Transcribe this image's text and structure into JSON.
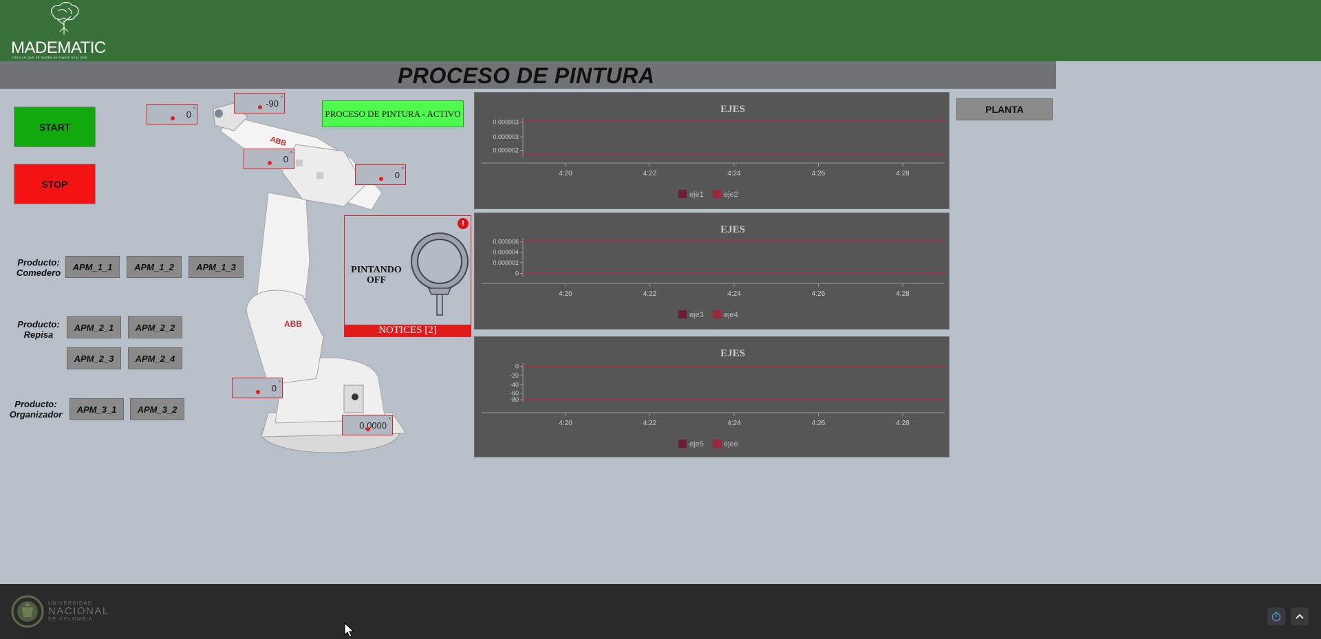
{
  "header": {
    "brand": "MADEMATIC",
    "brand_sub": "TODO LO QUE SE SUEÑA SE PUEDE REALIZAR",
    "title": "PROCESO DE PINTURA"
  },
  "controls": {
    "start_label": "START",
    "stop_label": "STOP",
    "status_text": "PROCESO DE PINTURA - ACTIVO",
    "planta_label": "PLANTA"
  },
  "products": [
    {
      "label": "Producto: Comedero",
      "label_line1": "Producto:",
      "label_line2": "Comedero",
      "buttons": [
        "APM_1_1",
        "APM_1_2",
        "APM_1_3"
      ]
    },
    {
      "label": "Producto: Repisa",
      "label_line1": "Producto:",
      "label_line2": "Repisa",
      "buttons": [
        "APM_2_1",
        "APM_2_2",
        "APM_2_3",
        "APM_2_4"
      ]
    },
    {
      "label": "Producto: Organizador",
      "label_line1": "Producto:",
      "label_line2": "Organizador",
      "buttons": [
        "APM_3_1",
        "APM_3_2"
      ]
    }
  ],
  "angles": {
    "a1": "0",
    "a2": "-90",
    "a3": "0",
    "a4": "0",
    "a5": "0",
    "a6": "0,0000",
    "unit": "°"
  },
  "paint": {
    "label_line1": "PINTANDO",
    "label_line2": "OFF",
    "notices": "NOTICES [2]",
    "alert": "!"
  },
  "charts_text": {
    "c1_title": "EJES",
    "c2_title": "EJES",
    "c3_title": "EJES"
  },
  "chart_data": [
    {
      "type": "line",
      "title": "EJES",
      "x": [
        "4:20",
        "4:22",
        "4:24",
        "4:26",
        "4:28"
      ],
      "y_ticks": [
        "0.000003",
        "0.000003",
        "0.000002"
      ],
      "series": [
        {
          "name": "eje1",
          "values": [
            3e-06,
            3e-06,
            3e-06,
            3e-06,
            3e-06
          ],
          "color": "#6e1e33"
        },
        {
          "name": "eje2",
          "values": [
            1.8e-06,
            1.8e-06,
            1.8e-06,
            1.8e-06,
            1.8e-06
          ],
          "color": "#9a2a3a"
        }
      ],
      "legend": "bottom"
    },
    {
      "type": "line",
      "title": "EJES",
      "x": [
        "4:20",
        "4:22",
        "4:24",
        "4:26",
        "4:28"
      ],
      "y_ticks": [
        "0.000006",
        "0.000004",
        "0.000002",
        "0"
      ],
      "series": [
        {
          "name": "eje3",
          "values": [
            6.2e-06,
            6.2e-06,
            6.2e-06,
            6.2e-06,
            6.2e-06
          ],
          "color": "#6e1e33"
        },
        {
          "name": "eje4",
          "values": [
            0,
            0,
            0,
            0,
            0
          ],
          "color": "#9a2a3a"
        }
      ],
      "legend": "bottom"
    },
    {
      "type": "line",
      "title": "EJES",
      "x": [
        "4:20",
        "4:22",
        "4:24",
        "4:26",
        "4:28"
      ],
      "y_ticks": [
        "0",
        "-20",
        "-40",
        "-60",
        "-80"
      ],
      "series": [
        {
          "name": "eje5",
          "values": [
            0,
            0,
            0,
            0,
            0
          ],
          "color": "#6e1e33"
        },
        {
          "name": "eje6",
          "values": [
            -90,
            -90,
            -90,
            -90,
            -90
          ],
          "color": "#9a2a3a"
        }
      ],
      "legend": "bottom"
    }
  ],
  "footer": {
    "univ_line1": "UNIVERSIDAD",
    "univ_line2": "NACIONAL",
    "univ_line3": "DE COLOMBIA"
  },
  "colors": {
    "header_green": "#38703a",
    "title_bar": "#6f7378",
    "background": "#b7bfc9",
    "start": "#12a90f",
    "stop": "#f41313",
    "status": "#4dfa4d",
    "alert_red": "#e01b1b",
    "chart_bg": "#565656",
    "footer": "#2a2a2a"
  }
}
